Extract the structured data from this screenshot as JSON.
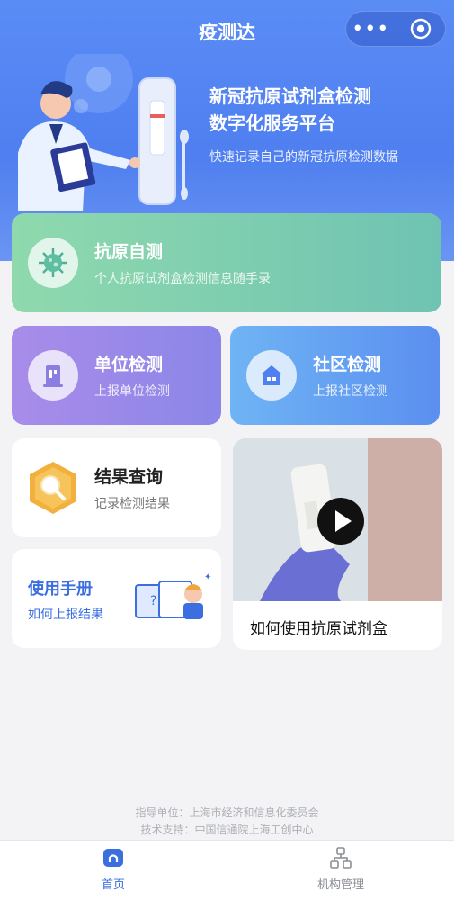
{
  "header": {
    "title": "疫测达",
    "more_icon": "more-dots-icon",
    "close_icon": "target-circle-icon"
  },
  "banner": {
    "headline_line1": "新冠抗原试剂盒检测",
    "headline_line2": "数字化服务平台",
    "subtitle": "快速记录自己的新冠抗原检测数据"
  },
  "cards": {
    "antigen": {
      "title": "抗原自测",
      "subtitle": "个人抗原试剂盒检测信息随手录",
      "icon": "virus-icon"
    },
    "unit": {
      "title": "单位检测",
      "subtitle": "上报单位检测",
      "icon": "building-icon"
    },
    "community": {
      "title": "社区检测",
      "subtitle": "上报社区检测",
      "icon": "house-icon"
    },
    "result": {
      "title": "结果查询",
      "subtitle": "记录检测结果",
      "icon": "magnifier-icon"
    },
    "manual": {
      "title": "使用手册",
      "subtitle": "如何上报结果",
      "icon": "manual-illustration-icon"
    },
    "video": {
      "title": "如何使用抗原试剂盒",
      "icon": "play-icon"
    }
  },
  "footer": {
    "line1": "指导单位：上海市经济和信息化委员会",
    "line2": "技术支持：中国信通院上海工创中心"
  },
  "tabbar": {
    "items": [
      {
        "label": "首页",
        "icon": "home-icon",
        "active": true
      },
      {
        "label": "机构管理",
        "icon": "org-chart-icon",
        "active": false
      }
    ]
  },
  "colors": {
    "primary": "#4f7ff0",
    "antigen_card": "#7fcfb0",
    "unit_card": "#9a89e8",
    "community_card": "#63a0f2",
    "result_icon": "#f0ad3a",
    "manual_title": "#3b6fe0"
  }
}
